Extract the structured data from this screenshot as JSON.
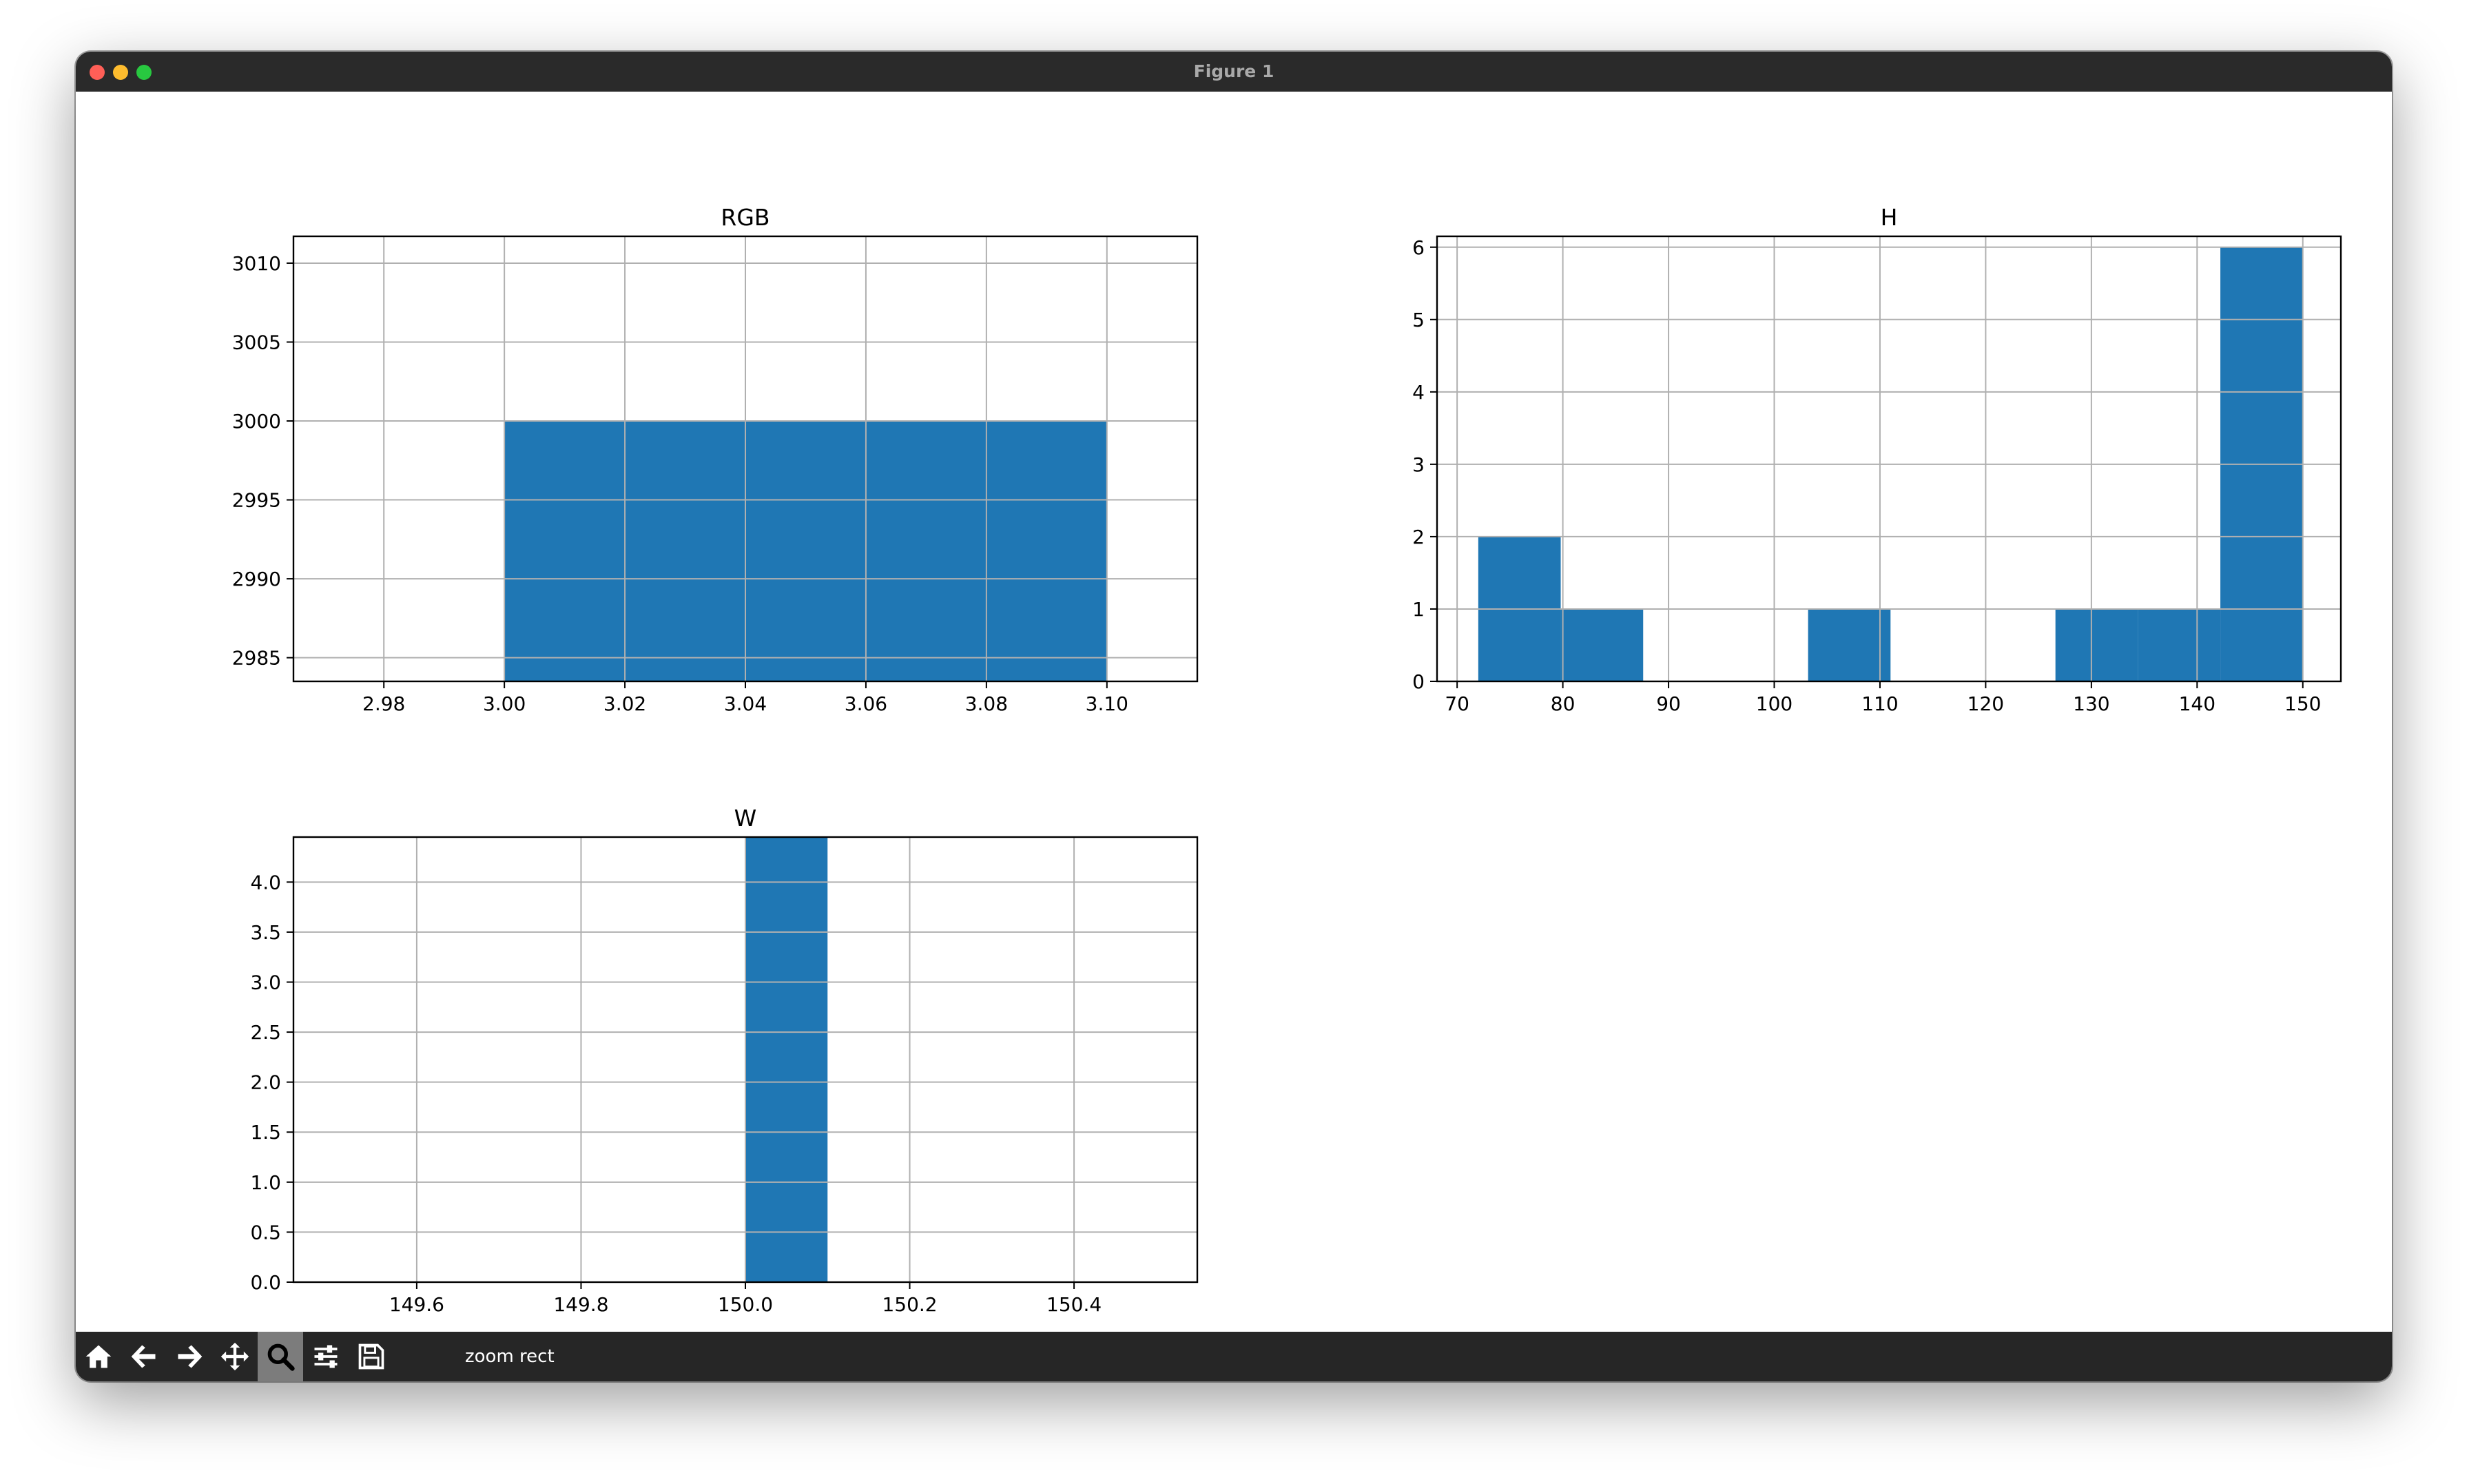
{
  "window": {
    "title": "Figure 1"
  },
  "toolbar": {
    "buttons": [
      {
        "name": "home-button",
        "icon": "home-icon"
      },
      {
        "name": "back-button",
        "icon": "arrow-left-icon"
      },
      {
        "name": "forward-button",
        "icon": "arrow-right-icon"
      },
      {
        "name": "pan-button",
        "icon": "move-icon"
      },
      {
        "name": "zoom-button",
        "icon": "magnifier-icon",
        "active": true
      },
      {
        "name": "configure-subplots-button",
        "icon": "sliders-icon"
      },
      {
        "name": "save-button",
        "icon": "floppy-disk-icon"
      }
    ],
    "status": "zoom rect"
  },
  "colors": {
    "bar": "#1f77b4",
    "grid": "#b0b0b0",
    "axis": "#000000",
    "titlebar": "#2a2a2a",
    "toolbar": "#262626"
  },
  "chart_data": [
    {
      "type": "bar",
      "title": "RGB",
      "xlim": [
        2.965,
        3.115
      ],
      "ylim": [
        2983.5,
        3011.7
      ],
      "xticks": [
        2.98,
        3.0,
        3.02,
        3.04,
        3.06,
        3.08,
        3.1
      ],
      "xtick_labels": [
        "2.98",
        "3.00",
        "3.02",
        "3.04",
        "3.06",
        "3.08",
        "3.10"
      ],
      "yticks": [
        2985,
        2990,
        2995,
        3000,
        3005,
        3010
      ],
      "ytick_labels": [
        "2985",
        "2990",
        "2995",
        "3000",
        "3005",
        "3010"
      ],
      "grid": true,
      "bars": [
        {
          "x0": 3.0,
          "x1": 3.02,
          "value": 3000
        },
        {
          "x0": 3.02,
          "x1": 3.04,
          "value": 3000
        },
        {
          "x0": 3.04,
          "x1": 3.06,
          "value": 3000
        },
        {
          "x0": 3.06,
          "x1": 3.08,
          "value": 3000
        },
        {
          "x0": 3.08,
          "x1": 3.1,
          "value": 3000
        }
      ]
    },
    {
      "type": "bar",
      "title": "H",
      "xlim": [
        68.1,
        153.6
      ],
      "ylim": [
        0,
        6.15
      ],
      "xticks": [
        70,
        80,
        90,
        100,
        110,
        120,
        130,
        140,
        150
      ],
      "xtick_labels": [
        "70",
        "80",
        "90",
        "100",
        "110",
        "120",
        "130",
        "140",
        "150"
      ],
      "yticks": [
        0,
        1,
        2,
        3,
        4,
        5,
        6
      ],
      "ytick_labels": [
        "0",
        "1",
        "2",
        "3",
        "4",
        "5",
        "6"
      ],
      "grid": true,
      "bars": [
        {
          "x0": 72.0,
          "x1": 79.8,
          "value": 2
        },
        {
          "x0": 79.8,
          "x1": 87.6,
          "value": 1
        },
        {
          "x0": 87.6,
          "x1": 95.4,
          "value": 0
        },
        {
          "x0": 95.4,
          "x1": 103.2,
          "value": 0
        },
        {
          "x0": 103.2,
          "x1": 111.0,
          "value": 1
        },
        {
          "x0": 111.0,
          "x1": 118.8,
          "value": 0
        },
        {
          "x0": 118.8,
          "x1": 126.6,
          "value": 0
        },
        {
          "x0": 126.6,
          "x1": 134.4,
          "value": 1
        },
        {
          "x0": 134.4,
          "x1": 142.2,
          "value": 1
        },
        {
          "x0": 142.2,
          "x1": 150.0,
          "value": 6
        }
      ]
    },
    {
      "type": "bar",
      "title": "W",
      "xlim": [
        149.45,
        150.55
      ],
      "ylim": [
        0,
        4.45
      ],
      "xticks": [
        149.6,
        149.8,
        150.0,
        150.2,
        150.4
      ],
      "xtick_labels": [
        "149.6",
        "149.8",
        "150.0",
        "150.2",
        "150.4"
      ],
      "yticks": [
        0,
        0.5,
        1.0,
        1.5,
        2.0,
        2.5,
        3.0,
        3.5,
        4.0
      ],
      "ytick_labels": [
        "0.0",
        "0.5",
        "1.0",
        "1.5",
        "2.0",
        "2.5",
        "3.0",
        "3.5",
        "4.0"
      ],
      "grid": true,
      "bars": [
        {
          "x0": 150.0,
          "x1": 150.1,
          "value": 4.45
        }
      ]
    }
  ]
}
